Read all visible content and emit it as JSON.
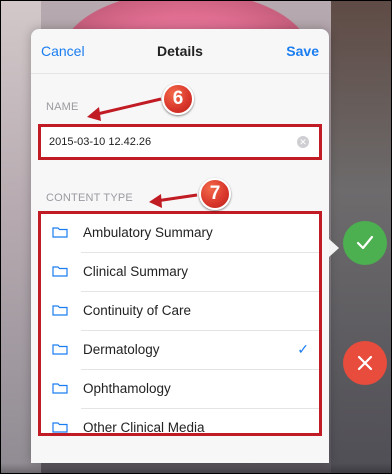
{
  "nav": {
    "cancel_label": "Cancel",
    "title": "Details",
    "save_label": "Save"
  },
  "name_section": {
    "label": "NAME",
    "value": "2015-03-10 12.42.26",
    "clear_icon": "clear-circle-icon"
  },
  "content_type_section": {
    "label": "CONTENT TYPE",
    "items": [
      {
        "label": "Ambulatory Summary",
        "icon": "folder-icon",
        "selected": false
      },
      {
        "label": "Clinical Summary",
        "icon": "folder-icon",
        "selected": false
      },
      {
        "label": "Continuity of Care",
        "icon": "folder-icon",
        "selected": false
      },
      {
        "label": "Dermatology",
        "icon": "folder-icon",
        "selected": true
      },
      {
        "label": "Ophthamology",
        "icon": "folder-icon",
        "selected": false
      },
      {
        "label": "Other Clinical Media",
        "icon": "folder-icon",
        "selected": false
      }
    ]
  },
  "annotations": {
    "name_badge": "6",
    "content_type_badge": "7"
  },
  "actions": {
    "accept_icon": "checkmark-icon",
    "reject_icon": "close-icon"
  },
  "colors": {
    "accent": "#1a7df0",
    "highlight": "#c11b24",
    "accept": "#4caf50",
    "reject": "#e74c3c"
  }
}
